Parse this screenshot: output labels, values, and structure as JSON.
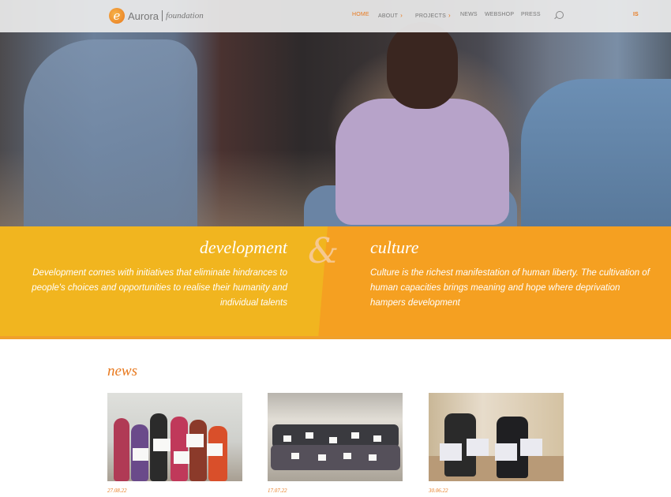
{
  "header": {
    "logo": {
      "mark": "e",
      "name": "Aurora",
      "sub": "foundation"
    },
    "nav": [
      {
        "label": "HOME",
        "active": true
      },
      {
        "label": "ABOUT",
        "has_dropdown": true
      },
      {
        "label": "PROJECTS",
        "has_dropdown": true
      },
      {
        "label": "NEWS"
      },
      {
        "label": "WEBSHOP"
      },
      {
        "label": "PRESS"
      }
    ],
    "search_icon": "search-icon",
    "language": "IS"
  },
  "band": {
    "ampersand": "&",
    "development": {
      "title": "development",
      "text": "Development comes with initiatives that eliminate hindrances to people's choices and opportunities to realise their humanity and individual talents"
    },
    "culture": {
      "title": "culture",
      "text": "Culture is the richest manifestation of human liberty. The cultivation of human capacities brings meaning and hope where deprivation hampers development"
    }
  },
  "news": {
    "heading": "news",
    "items": [
      {
        "date": "27.08.22"
      },
      {
        "date": "17.07.22"
      },
      {
        "date": "30.06.22"
      }
    ]
  },
  "colors": {
    "accent": "#e8791e",
    "band_yellow": "#f1b51f",
    "band_orange": "#f5a021"
  }
}
